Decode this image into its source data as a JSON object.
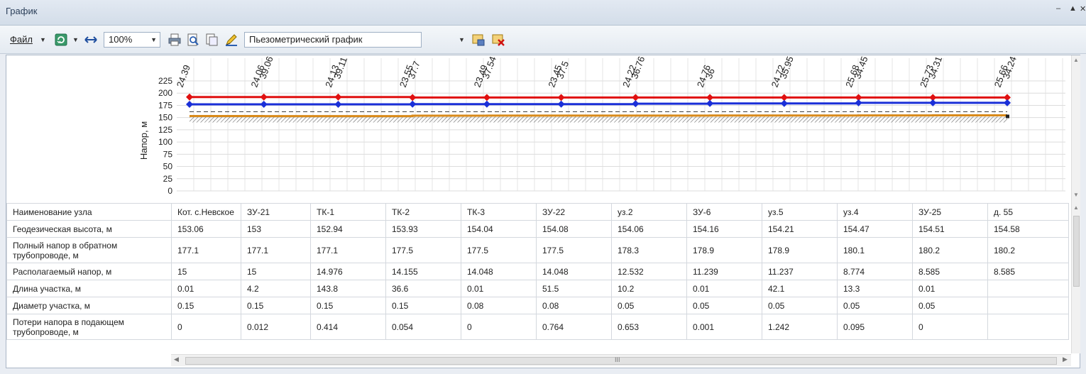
{
  "window": {
    "title": "График",
    "minimize": "–",
    "pin": "▲",
    "close": "✕"
  },
  "toolbar": {
    "file_label": "Файл",
    "zoom": "100%",
    "graph_type": "Пьезометрический график",
    "icons": [
      "refresh-icon",
      "fit-width-icon",
      "print-icon",
      "print-preview-icon",
      "page-setup-icon",
      "edit-icon",
      "save-layout-icon",
      "clear-layout-icon"
    ]
  },
  "chart_data": {
    "type": "line",
    "ylabel": "Напор, м",
    "y_ticks": [
      "225",
      "200",
      "175",
      "150",
      "125",
      "100",
      "75",
      "50",
      "25",
      "0"
    ],
    "ylim": [
      0,
      225
    ],
    "node_labels": [
      [
        "24.39"
      ],
      [
        "24.06",
        "39.06"
      ],
      [
        "24.13",
        "39.11"
      ],
      [
        "23.55",
        "37.7"
      ],
      [
        "23.49",
        "37.54"
      ],
      [
        "23.45",
        "37.5"
      ],
      [
        "24.22",
        "36.76"
      ],
      [
        "24.76",
        "36"
      ],
      [
        "24.72",
        "35.95"
      ],
      [
        "25.68",
        "34.45"
      ],
      [
        "25.73",
        "34.31"
      ],
      [
        "25.66",
        "34.24"
      ]
    ],
    "series": [
      {
        "name": "",
        "color": "#e01010",
        "values": [
          192,
          192,
          192,
          191,
          191,
          191,
          191,
          191,
          191,
          191,
          191,
          191
        ]
      },
      {
        "name": "",
        "color": "#1a2fd8",
        "values": [
          177.1,
          177.1,
          177.1,
          177.5,
          177.5,
          177.5,
          178.3,
          178.9,
          178.9,
          180.1,
          180.2,
          180.2
        ]
      },
      {
        "name": "",
        "color": "#333333",
        "values": [
          162,
          162,
          162,
          162,
          162,
          162,
          162,
          162,
          162,
          162,
          162,
          162
        ]
      },
      {
        "name": "",
        "color": "#d98a1a",
        "values": [
          153.06,
          153,
          152.94,
          153.93,
          154.04,
          154.08,
          154.06,
          154.16,
          154.21,
          154.47,
          154.51,
          154.58
        ]
      }
    ],
    "grid": true
  },
  "table": {
    "row_labels": [
      "Наименование узла",
      "Геодезическая высота, м",
      "Полный напор в обратном трубопроводе, м",
      "Располагаемый напор, м",
      "Длина участка, м",
      "Диаметр участка, м",
      "Потери напора в подающем трубопроводе, м"
    ],
    "rows": [
      [
        "Кот. с.Невское",
        "ЗУ-21",
        "ТК-1",
        "ТК-2",
        "ТК-3",
        "ЗУ-22",
        "уз.2",
        "ЗУ-6",
        "уз.5",
        "уз.4",
        "ЗУ-25",
        "д. 55"
      ],
      [
        "153.06",
        "153",
        "152.94",
        "153.93",
        "154.04",
        "154.08",
        "154.06",
        "154.16",
        "154.21",
        "154.47",
        "154.51",
        "154.58"
      ],
      [
        "177.1",
        "177.1",
        "177.1",
        "177.5",
        "177.5",
        "177.5",
        "178.3",
        "178.9",
        "178.9",
        "180.1",
        "180.2",
        "180.2"
      ],
      [
        "15",
        "15",
        "14.976",
        "14.155",
        "14.048",
        "14.048",
        "12.532",
        "11.239",
        "11.237",
        "8.774",
        "8.585",
        "8.585"
      ],
      [
        "0.01",
        "4.2",
        "143.8",
        "36.6",
        "0.01",
        "51.5",
        "10.2",
        "0.01",
        "42.1",
        "13.3",
        "0.01",
        ""
      ],
      [
        "0.15",
        "0.15",
        "0.15",
        "0.15",
        "0.08",
        "0.08",
        "0.05",
        "0.05",
        "0.05",
        "0.05",
        "0.05",
        ""
      ],
      [
        "0",
        "0.012",
        "0.414",
        "0.054",
        "0",
        "0.764",
        "0.653",
        "0.001",
        "1.242",
        "0.095",
        "0",
        ""
      ]
    ]
  },
  "hscroll_grip": "III"
}
